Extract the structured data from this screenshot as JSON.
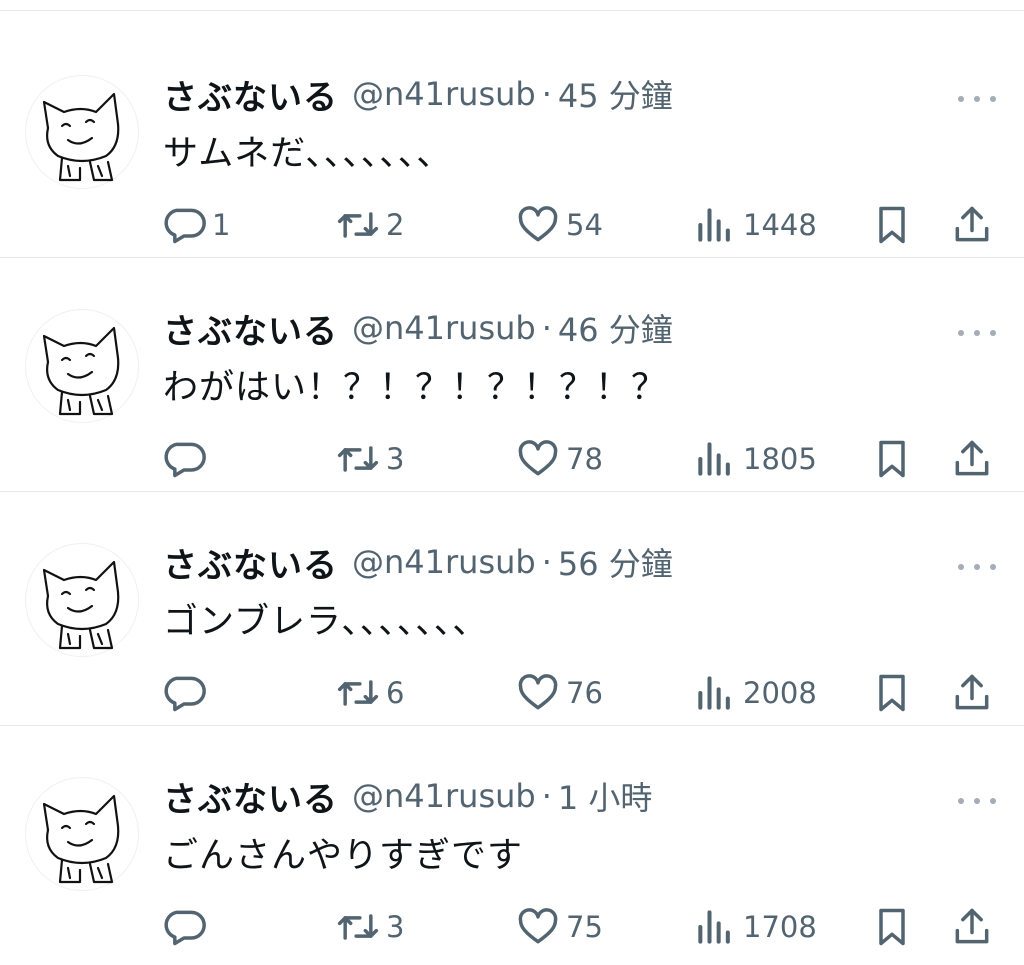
{
  "tweets": [
    {
      "name": "さぶないる",
      "handle": "@n41rusub",
      "separator": "·",
      "time": "45 分鐘",
      "text": "サムネだ、、、、、、、",
      "replies": "1",
      "retweets": "2",
      "likes": "54",
      "views": "1448"
    },
    {
      "name": "さぶないる",
      "handle": "@n41rusub",
      "separator": "·",
      "time": "46 分鐘",
      "text": "わがはい！？！？！？！？！？",
      "replies": "",
      "retweets": "3",
      "likes": "78",
      "views": "1805"
    },
    {
      "name": "さぶないる",
      "handle": "@n41rusub",
      "separator": "·",
      "time": "56 分鐘",
      "text": "ゴンブレラ、、、、、、、",
      "replies": "",
      "retweets": "6",
      "likes": "76",
      "views": "2008"
    },
    {
      "name": "さぶないる",
      "handle": "@n41rusub",
      "separator": "·",
      "time": "1 小時",
      "text": "ごんさんやりすぎです",
      "replies": "",
      "retweets": "3",
      "likes": "75",
      "views": "1708"
    }
  ],
  "icons": {
    "avatar": "cat-drawing-avatar",
    "more": "more-options-icon",
    "reply": "reply-icon",
    "retweet": "retweet-icon",
    "like": "heart-icon",
    "views": "views-chart-icon",
    "bookmark": "bookmark-icon",
    "share": "share-icon"
  },
  "colors": {
    "text": "#0f1419",
    "secondary": "#536471",
    "divider": "#e6e9ec"
  }
}
